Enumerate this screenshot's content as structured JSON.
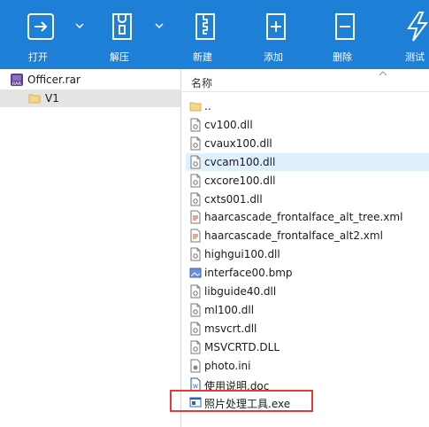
{
  "toolbar": {
    "buttons": [
      {
        "label": "打开",
        "icon": "open-icon"
      },
      {
        "label": "解压",
        "icon": "extract-icon"
      },
      {
        "label": "新建",
        "icon": "new-icon"
      },
      {
        "label": "添加",
        "icon": "add-icon"
      },
      {
        "label": "删除",
        "icon": "delete-icon"
      },
      {
        "label": "测试",
        "icon": "test-icon"
      }
    ],
    "color": "#1e7fd7"
  },
  "tree": {
    "archive": "Officer.rar",
    "folder": "V1"
  },
  "file_list": {
    "column_header": "名称",
    "items": [
      {
        "name": "..",
        "icon": "folder-icon"
      },
      {
        "name": "cv100.dll",
        "icon": "dll-file-icon"
      },
      {
        "name": "cvaux100.dll",
        "icon": "dll-file-icon"
      },
      {
        "name": "cvcam100.dll",
        "icon": "dll-file-icon"
      },
      {
        "name": "cxcore100.dll",
        "icon": "dll-file-icon"
      },
      {
        "name": "cxts001.dll",
        "icon": "dll-file-icon"
      },
      {
        "name": "haarcascade_frontalface_alt_tree.xml",
        "icon": "xml-file-icon"
      },
      {
        "name": "haarcascade_frontalface_alt2.xml",
        "icon": "xml-file-icon"
      },
      {
        "name": "highgui100.dll",
        "icon": "dll-file-icon"
      },
      {
        "name": "interface00.bmp",
        "icon": "bmp-file-icon"
      },
      {
        "name": "libguide40.dll",
        "icon": "dll-file-icon"
      },
      {
        "name": "ml100.dll",
        "icon": "dll-file-icon"
      },
      {
        "name": "msvcrt.dll",
        "icon": "dll-file-icon"
      },
      {
        "name": "MSVCRTD.DLL",
        "icon": "dll-file-icon"
      },
      {
        "name": "photo.ini",
        "icon": "ini-file-icon"
      },
      {
        "name": "使用说明.doc",
        "icon": "doc-file-icon"
      },
      {
        "name": "照片处理工具.exe",
        "icon": "exe-file-icon"
      }
    ]
  },
  "highlight_color": "#e53935"
}
